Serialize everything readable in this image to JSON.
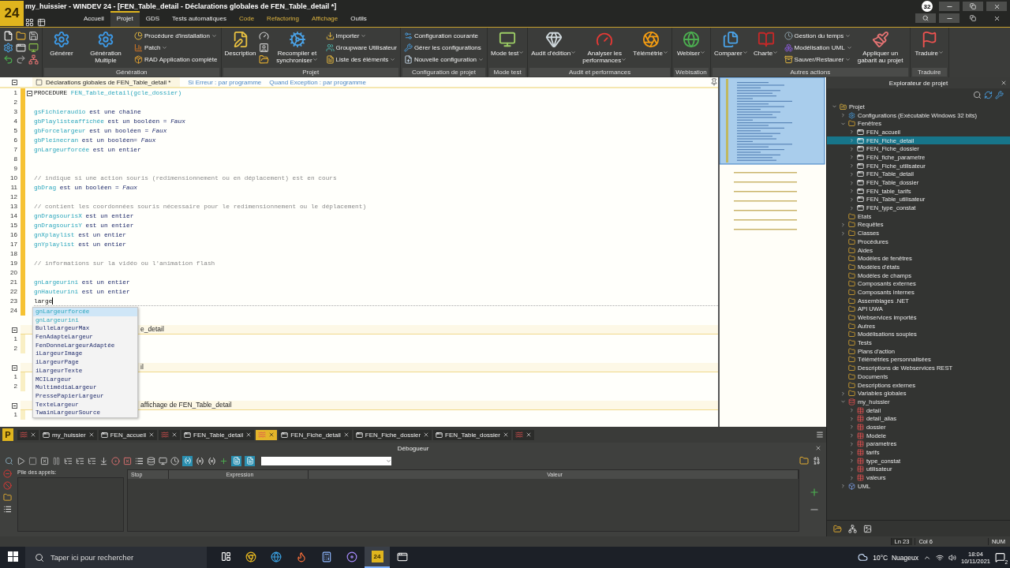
{
  "window": {
    "logo": "24",
    "title": "my_huissier - WINDEV 24 - [FEN_Table_detail - Déclarations globales de FEN_Table_detail *]",
    "badge": "32"
  },
  "menu_tabs": [
    {
      "label": "Accueil",
      "selected": false,
      "contextual": false
    },
    {
      "label": "Projet",
      "selected": true,
      "contextual": false
    },
    {
      "label": "GDS",
      "selected": false,
      "contextual": false
    },
    {
      "label": "Tests automatiques",
      "selected": false,
      "contextual": false
    },
    {
      "label": "Code",
      "selected": false,
      "contextual": true
    },
    {
      "label": "Refactoring",
      "selected": false,
      "contextual": true
    },
    {
      "label": "Affichage",
      "selected": false,
      "contextual": true
    },
    {
      "label": "Outils",
      "selected": false,
      "contextual": false
    }
  ],
  "ribbon": [
    {
      "items": [
        {
          "kind": "icon"
        },
        {
          "kind": "icon"
        },
        {
          "kind": "icon"
        },
        {
          "kind": "icon"
        },
        {
          "kind": "icon"
        },
        {
          "kind": "icon"
        },
        {
          "kind": "icon"
        },
        {
          "kind": "icon"
        },
        {
          "kind": "icon"
        }
      ]
    },
    {
      "label": "Génération",
      "items": [
        {
          "kind": "large",
          "label": "Générer",
          "menu": false
        },
        {
          "kind": "large",
          "label": "Génération Multiple",
          "menu": false
        },
        {
          "kind": "small",
          "label": "Procédure d'installation",
          "menu": true
        },
        {
          "kind": "small",
          "label": "Patch",
          "menu": true
        },
        {
          "kind": "small",
          "label": "RAD Application complète",
          "menu": false
        }
      ]
    },
    {
      "label": "Projet",
      "items": [
        {
          "kind": "large",
          "label": "Description",
          "menu": false
        },
        {
          "kind": "icon"
        },
        {
          "kind": "icon"
        },
        {
          "kind": "icon"
        },
        {
          "kind": "large",
          "label": "Recompiler et synchroniser",
          "menu": true
        },
        {
          "kind": "small",
          "label": "Importer",
          "menu": true
        },
        {
          "kind": "small",
          "label": "Groupware Utilisateur",
          "menu": false
        },
        {
          "kind": "small",
          "label": "Liste des éléments",
          "menu": true
        }
      ]
    },
    {
      "label": "Configuration de projet",
      "items": [
        {
          "kind": "small",
          "label": "Configuration courante",
          "menu": false
        },
        {
          "kind": "small",
          "label": "Gérer les configurations",
          "menu": false
        },
        {
          "kind": "small",
          "label": "Nouvelle configuration",
          "menu": true
        }
      ]
    },
    {
      "label": "Mode test",
      "items": [
        {
          "kind": "large",
          "label": "Mode test",
          "menu": true
        }
      ]
    },
    {
      "label": "Audit et performances",
      "items": [
        {
          "kind": "large",
          "label": "Audit d'édition",
          "menu": true
        },
        {
          "kind": "large",
          "label": "Analyser les performances",
          "menu": true
        },
        {
          "kind": "large",
          "label": "Télémétrie",
          "menu": true
        }
      ]
    },
    {
      "label": "Webisation",
      "items": [
        {
          "kind": "large",
          "label": "Webiser",
          "menu": true
        }
      ]
    },
    {
      "label": "Autres actions",
      "items": [
        {
          "kind": "large",
          "label": "Comparer",
          "menu": true
        },
        {
          "kind": "large",
          "label": "Charte",
          "menu": true
        },
        {
          "kind": "small",
          "label": "Gestion du temps",
          "menu": true
        },
        {
          "kind": "small",
          "label": "Modélisation UML",
          "menu": true
        },
        {
          "kind": "small",
          "label": "Sauver/Restaurer",
          "menu": true
        },
        {
          "kind": "large",
          "label": "Appliquer un gabarit au projet",
          "menu": false
        }
      ]
    },
    {
      "label": "Traduire",
      "items": [
        {
          "kind": "large",
          "label": "Traduire",
          "menu": true
        }
      ]
    }
  ],
  "editor": {
    "header": "Déclarations globales de FEN_Table_detail *",
    "on_error": "Si Erreur : par programme",
    "on_exception": "Quand Exception : par programme",
    "lines": [
      {
        "n": "1",
        "fold": true,
        "current": false,
        "tokens": [
          {
            "kind": "plain",
            "text": "PROCEDURE "
          },
          {
            "kind": "var",
            "text": "FEN_Table_detail(gcle_dossier)"
          }
        ]
      },
      {
        "n": "2",
        "fold": false,
        "current": false
      },
      {
        "n": "3",
        "fold": false,
        "current": false,
        "tokens": [
          {
            "kind": "var",
            "text": "gsFichieraudio"
          },
          {
            "kind": "kw",
            "text": " est une chaîne"
          }
        ]
      },
      {
        "n": "4",
        "fold": false,
        "current": false,
        "tokens": [
          {
            "kind": "var",
            "text": "gbPlaylisteaffichée"
          },
          {
            "kind": "kw",
            "text": " est un booléen = "
          },
          {
            "kind": "bool",
            "text": "Faux"
          }
        ]
      },
      {
        "n": "5",
        "fold": false,
        "current": false,
        "tokens": [
          {
            "kind": "var",
            "text": "gbForcelargeur"
          },
          {
            "kind": "kw",
            "text": " est un booléen = "
          },
          {
            "kind": "bool",
            "text": "Faux"
          }
        ]
      },
      {
        "n": "6",
        "fold": false,
        "current": false,
        "tokens": [
          {
            "kind": "var",
            "text": "gbPleinecran"
          },
          {
            "kind": "kw",
            "text": " est un booléen= "
          },
          {
            "kind": "bool",
            "text": "Faux"
          }
        ]
      },
      {
        "n": "7",
        "fold": false,
        "current": false,
        "tokens": [
          {
            "kind": "var",
            "text": "gnLargeurforcée"
          },
          {
            "kind": "kw",
            "text": " est un entier"
          }
        ]
      },
      {
        "n": "8",
        "fold": false,
        "current": false
      },
      {
        "n": "9",
        "fold": false,
        "current": false
      },
      {
        "n": "10",
        "fold": false,
        "current": false,
        "tokens": [
          {
            "kind": "comment",
            "text": "// indique si une action souris (redimensionnement ou en déplacement) est en cours"
          }
        ]
      },
      {
        "n": "11",
        "fold": false,
        "current": false,
        "tokens": [
          {
            "kind": "var",
            "text": "gbDrag"
          },
          {
            "kind": "kw",
            "text": " est un booléen = "
          },
          {
            "kind": "bool",
            "text": "Faux"
          }
        ]
      },
      {
        "n": "12",
        "fold": false,
        "current": false
      },
      {
        "n": "13",
        "fold": false,
        "current": false,
        "tokens": [
          {
            "kind": "comment",
            "text": "// contient les coordonnées souris nécessaire pour le redimensionnement ou le déplacement)"
          }
        ]
      },
      {
        "n": "14",
        "fold": false,
        "current": false,
        "tokens": [
          {
            "kind": "var",
            "text": "gnDragsourisX"
          },
          {
            "kind": "kw",
            "text": " est un entier"
          }
        ]
      },
      {
        "n": "15",
        "fold": false,
        "current": false,
        "tokens": [
          {
            "kind": "var",
            "text": "gnDragsourisY"
          },
          {
            "kind": "kw",
            "text": " est un entier"
          }
        ]
      },
      {
        "n": "16",
        "fold": false,
        "current": false,
        "tokens": [
          {
            "kind": "var",
            "text": "gnXplaylist"
          },
          {
            "kind": "kw",
            "text": " est un entier"
          }
        ]
      },
      {
        "n": "17",
        "fold": false,
        "current": false,
        "tokens": [
          {
            "kind": "var",
            "text": "gnYplaylist"
          },
          {
            "kind": "kw",
            "text": " est un entier"
          }
        ]
      },
      {
        "n": "18",
        "fold": false,
        "current": false
      },
      {
        "n": "19",
        "fold": false,
        "current": false,
        "tokens": [
          {
            "kind": "comment",
            "text": "// informations sur la vidéo ou l'animation flash"
          }
        ]
      },
      {
        "n": "20",
        "fold": false,
        "current": false
      },
      {
        "n": "21",
        "fold": false,
        "current": false,
        "tokens": [
          {
            "kind": "var",
            "text": "gnLargeurini"
          },
          {
            "kind": "kw",
            "text": " est un entier"
          }
        ]
      },
      {
        "n": "22",
        "fold": false,
        "current": false,
        "tokens": [
          {
            "kind": "var",
            "text": "gnHauteurini"
          },
          {
            "kind": "kw",
            "text": " est un entier"
          }
        ]
      },
      {
        "n": "23",
        "fold": false,
        "current": true,
        "tokens": [
          {
            "kind": "plain",
            "text": "large"
          }
        ]
      },
      {
        "n": "24",
        "fold": false,
        "current": false
      }
    ],
    "sections": [
      {
        "title": "e_detail",
        "lines": [
          "1",
          "2"
        ]
      },
      {
        "title": "il",
        "lines": [
          "1",
          "2"
        ]
      },
      {
        "title": "affichage de FEN_Table_detail",
        "lines": [
          "1"
        ]
      }
    ],
    "completions": [
      {
        "text": "gnLargeurforcée",
        "kind": "variable",
        "selected": true
      },
      {
        "text": "gnLargeurini",
        "kind": "variable",
        "selected": false
      },
      {
        "text": "BulleLargeurMax",
        "kind": "function",
        "selected": false
      },
      {
        "text": "FenAdapteLargeur",
        "kind": "function",
        "selected": false
      },
      {
        "text": "FenDonneLargeurAdaptée",
        "kind": "function",
        "selected": false
      },
      {
        "text": "iLargeurImage",
        "kind": "function",
        "selected": false
      },
      {
        "text": "iLargeurPage",
        "kind": "function",
        "selected": false
      },
      {
        "text": "iLargeurTexte",
        "kind": "function",
        "selected": false
      },
      {
        "text": "MCILargeur",
        "kind": "function",
        "selected": false
      },
      {
        "text": "MultimédiaLargeur",
        "kind": "function",
        "selected": false
      },
      {
        "text": "PressePapierLargeur",
        "kind": "function",
        "selected": false
      },
      {
        "text": "TexteLargeur",
        "kind": "function",
        "selected": false
      },
      {
        "text": "TwainLargeurSource",
        "kind": "function",
        "selected": false
      }
    ]
  },
  "document_tabs": {
    "badge": "P",
    "tabs": [
      {
        "kind": "icon",
        "selected": false
      },
      {
        "kind": "label",
        "label": "my_huissier",
        "selected": false
      },
      {
        "kind": "label",
        "label": "FEN_accueil",
        "selected": false
      },
      {
        "kind": "icon",
        "selected": false
      },
      {
        "kind": "label",
        "label": "FEN_Table_detail",
        "selected": false
      },
      {
        "kind": "icon",
        "selected": true
      },
      {
        "kind": "label",
        "label": "FEN_Fiche_detail",
        "selected": false
      },
      {
        "kind": "label",
        "label": "FEN_Fiche_dossier",
        "selected": false
      },
      {
        "kind": "label",
        "label": "FEN_Table_dossier",
        "selected": false
      },
      {
        "kind": "icon",
        "selected": false
      }
    ]
  },
  "debugger": {
    "title": "Débogueur",
    "call_stack_label": "Pile des appels:",
    "columns": [
      "Stop",
      "Expression",
      "Valeur"
    ]
  },
  "project_explorer": {
    "title": "Explorateur de projet",
    "tree": [
      {
        "label": "Projet",
        "kind": "project",
        "expandable": true,
        "expanded": true,
        "selected": false,
        "children": [
          {
            "label": "Configurations (Exécutable Windows 32 bits)",
            "kind": "config",
            "expandable": true,
            "expanded": false,
            "selected": false
          },
          {
            "label": "Fenêtres",
            "kind": "folder",
            "expandable": true,
            "expanded": true,
            "selected": false,
            "children": [
              {
                "label": "FEN_accueil",
                "kind": "window",
                "expandable": true,
                "expanded": false,
                "selected": false
              },
              {
                "label": "FEN_Fiche_detail",
                "kind": "window",
                "expandable": true,
                "expanded": false,
                "selected": true
              },
              {
                "label": "FEN_Fiche_dossier",
                "kind": "window",
                "expandable": true,
                "expanded": false,
                "selected": false
              },
              {
                "label": "FEN_fiche_parametre",
                "kind": "window",
                "expandable": true,
                "expanded": false,
                "selected": false
              },
              {
                "label": "FEN_Fiche_utilisateur",
                "kind": "window",
                "expandable": true,
                "expanded": false,
                "selected": false
              },
              {
                "label": "FEN_Table_detail",
                "kind": "window",
                "expandable": true,
                "expanded": false,
                "selected": false
              },
              {
                "label": "FEN_Table_dossier",
                "kind": "window",
                "expandable": true,
                "expanded": false,
                "selected": false
              },
              {
                "label": "FEN_table_tarifs",
                "kind": "window",
                "expandable": true,
                "expanded": false,
                "selected": false
              },
              {
                "label": "FEN_Table_utilisateur",
                "kind": "window",
                "expandable": true,
                "expanded": false,
                "selected": false
              },
              {
                "label": "FEN_type_constat",
                "kind": "window",
                "expandable": true,
                "expanded": false,
                "selected": false
              }
            ]
          },
          {
            "label": "Etats",
            "kind": "folder",
            "expandable": false,
            "expanded": false,
            "selected": false
          },
          {
            "label": "Requêtes",
            "kind": "folder",
            "expandable": true,
            "expanded": false,
            "selected": false
          },
          {
            "label": "Classes",
            "kind": "folder",
            "expandable": true,
            "expanded": false,
            "selected": false
          },
          {
            "label": "Procédures",
            "kind": "folder",
            "expandable": false,
            "expanded": false,
            "selected": false
          },
          {
            "label": "Aides",
            "kind": "folder",
            "expandable": false,
            "expanded": false,
            "selected": false
          },
          {
            "label": "Modèles de fenêtres",
            "kind": "folder",
            "expandable": false,
            "expanded": false,
            "selected": false
          },
          {
            "label": "Modèles d'états",
            "kind": "folder",
            "expandable": false,
            "expanded": false,
            "selected": false
          },
          {
            "label": "Modèles de champs",
            "kind": "folder",
            "expandable": false,
            "expanded": false,
            "selected": false
          },
          {
            "label": "Composants externes",
            "kind": "folder",
            "expandable": false,
            "expanded": false,
            "selected": false
          },
          {
            "label": "Composants internes",
            "kind": "folder",
            "expandable": false,
            "expanded": false,
            "selected": false
          },
          {
            "label": "Assemblages .NET",
            "kind": "folder",
            "expandable": false,
            "expanded": false,
            "selected": false
          },
          {
            "label": "API UWA",
            "kind": "folder",
            "expandable": false,
            "expanded": false,
            "selected": false
          },
          {
            "label": "Webservices importés",
            "kind": "folder",
            "expandable": false,
            "expanded": false,
            "selected": false
          },
          {
            "label": "Autres",
            "kind": "folder",
            "expandable": false,
            "expanded": false,
            "selected": false
          },
          {
            "label": "Modélisations souples",
            "kind": "folder",
            "expandable": false,
            "expanded": false,
            "selected": false
          },
          {
            "label": "Tests",
            "kind": "folder",
            "expandable": false,
            "expanded": false,
            "selected": false
          },
          {
            "label": "Plans d'action",
            "kind": "folder",
            "expandable": false,
            "expanded": false,
            "selected": false
          },
          {
            "label": "Télémétries personnalisées",
            "kind": "folder",
            "expandable": false,
            "expanded": false,
            "selected": false
          },
          {
            "label": "Descriptions de Webservices REST",
            "kind": "folder",
            "expandable": false,
            "expanded": false,
            "selected": false
          },
          {
            "label": "Documents",
            "kind": "folder",
            "expandable": false,
            "expanded": false,
            "selected": false
          },
          {
            "label": "Descriptions externes",
            "kind": "folder",
            "expandable": false,
            "expanded": false,
            "selected": false
          },
          {
            "label": "Variables globales",
            "kind": "folder",
            "expandable": true,
            "expanded": false,
            "selected": false
          },
          {
            "label": "my_huissier",
            "kind": "analysis",
            "expandable": true,
            "expanded": true,
            "selected": false,
            "children": [
              {
                "label": "detail",
                "kind": "table",
                "expandable": true,
                "expanded": false,
                "selected": false
              },
              {
                "label": "detail_alias",
                "kind": "table",
                "expandable": true,
                "expanded": false,
                "selected": false
              },
              {
                "label": "dossier",
                "kind": "table",
                "expandable": true,
                "expanded": false,
                "selected": false
              },
              {
                "label": "Modele",
                "kind": "table",
                "expandable": true,
                "expanded": false,
                "selected": false
              },
              {
                "label": "parametres",
                "kind": "table",
                "expandable": true,
                "expanded": false,
                "selected": false
              },
              {
                "label": "tarifs",
                "kind": "table",
                "expandable": true,
                "expanded": false,
                "selected": false
              },
              {
                "label": "type_constat",
                "kind": "table",
                "expandable": true,
                "expanded": false,
                "selected": false
              },
              {
                "label": "utilisateur",
                "kind": "table",
                "expandable": true,
                "expanded": false,
                "selected": false
              },
              {
                "label": "valeurs",
                "kind": "table",
                "expandable": true,
                "expanded": false,
                "selected": false
              }
            ]
          },
          {
            "label": "UML",
            "kind": "model",
            "expandable": true,
            "expanded": false,
            "selected": false
          }
        ]
      }
    ]
  },
  "status_bar": {
    "line": "Ln 23",
    "column": "Col 6",
    "num_lock": "NUM"
  },
  "taskbar": {
    "search_placeholder": "Taper ici pour rechercher",
    "apps": [
      {
        "kind": "taskview",
        "active": false
      },
      {
        "kind": "chrome",
        "active": false
      },
      {
        "kind": "edge",
        "active": false
      },
      {
        "kind": "firefox",
        "active": false
      },
      {
        "kind": "calculator",
        "active": false
      },
      {
        "kind": "disc",
        "active": false
      },
      {
        "kind": "windev",
        "label": "24",
        "active": true
      },
      {
        "kind": "window",
        "active": false
      }
    ],
    "weather": "10°C  Nuageux",
    "time": "18:04",
    "date": "10/11/2021",
    "notifications": "2"
  }
}
